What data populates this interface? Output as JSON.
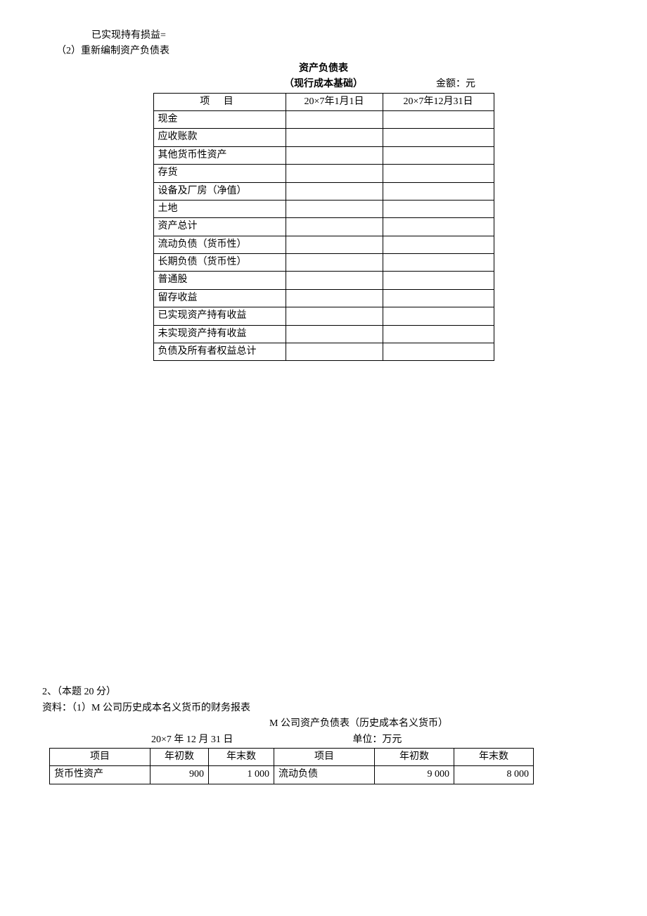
{
  "top": {
    "line1": "已实现持有损益=",
    "line2": "（2）重新编制资产负债表",
    "title": "资产负债表",
    "subtitle": "（现行成本基础）",
    "unit": "金额：元"
  },
  "table1": {
    "headers": [
      "项    目",
      "20×7年1月1日",
      "20×7年12月31日"
    ],
    "rows": [
      "现金",
      "应收账款",
      "其他货币性资产",
      "存货",
      "设备及厂房（净值）",
      "土地",
      "资产总计",
      "流动负债（货币性）",
      "长期负债（货币性）",
      "普通股",
      "留存收益",
      "已实现资产持有收益",
      "未实现资产持有收益",
      "负债及所有者权益总计"
    ]
  },
  "q2": {
    "line1": "2、（本题 20 分）",
    "line2": "资料：（1）M 公司历史成本名义货币的财务报表",
    "title": "M 公司资产负债表（历史成本名义货币）",
    "date": "20×7 年 12 月 31 日",
    "unit": "单位：万元"
  },
  "table2": {
    "headers": [
      "项目",
      "年初数",
      "年末数",
      "项目",
      "年初数",
      "年末数"
    ],
    "rows": [
      {
        "c1": "货币性资产",
        "c2": "900",
        "c3": "1  000",
        "c4": "流动负债",
        "c5": "9  000",
        "c6": "8  000"
      }
    ]
  }
}
